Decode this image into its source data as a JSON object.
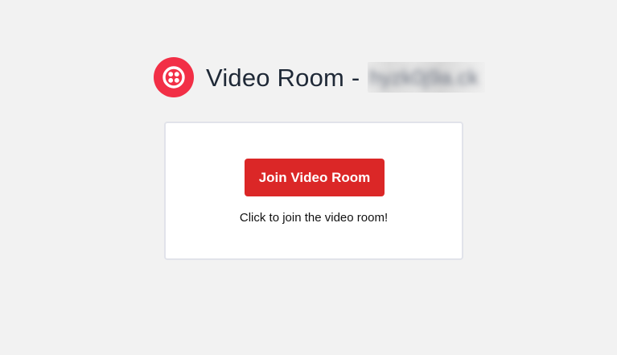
{
  "header": {
    "logo_icon": "twilio-logo-icon",
    "title": "Video Room -",
    "room_name": "hyzk0j9a.ck"
  },
  "card": {
    "join_button_label": "Join Video Room",
    "hint_text": "Click to join the video room!"
  },
  "colors": {
    "background": "#f2f2f2",
    "brand": "#f22f46",
    "button": "#db2727",
    "title_text": "#1f2937"
  }
}
